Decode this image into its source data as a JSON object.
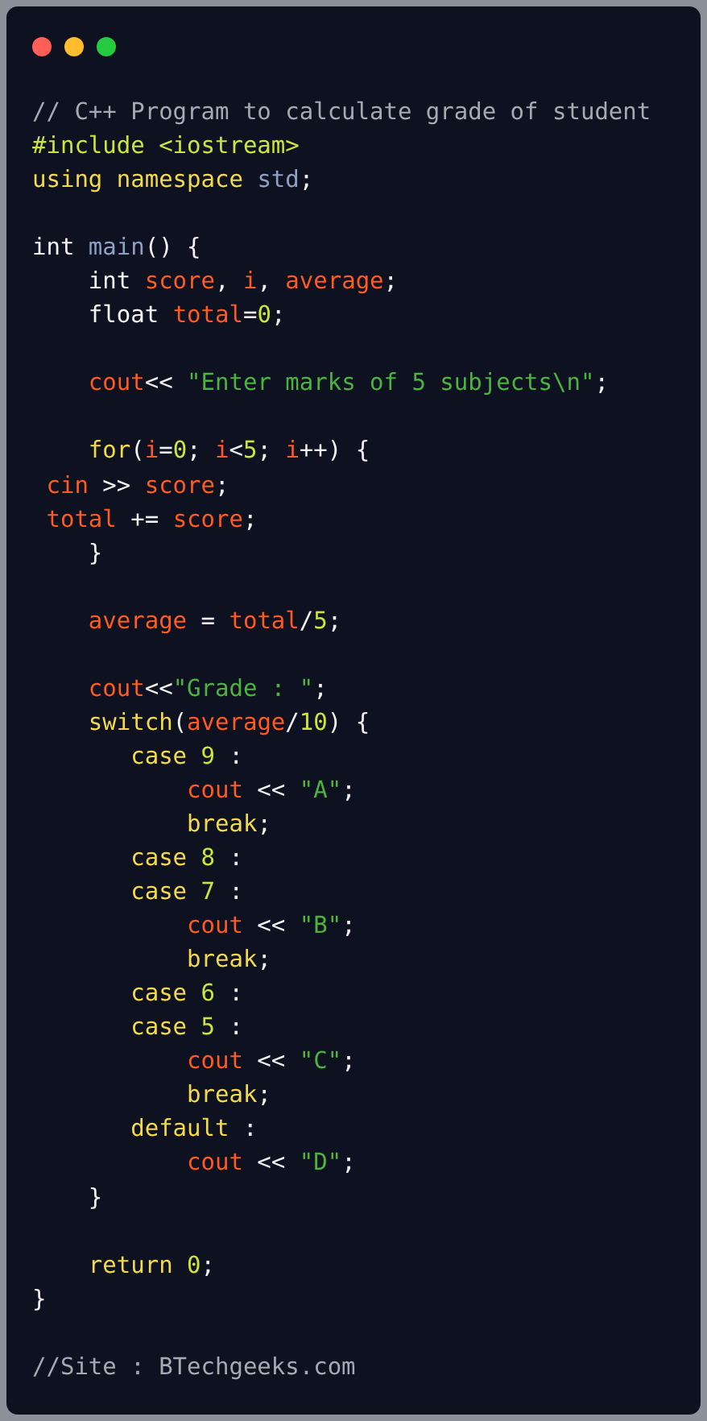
{
  "window_controls": [
    {
      "color": "#ff5f56"
    },
    {
      "color": "#ffbd2e"
    },
    {
      "color": "#27c93f"
    }
  ],
  "code_lines": [
    {
      "kind": "code",
      "tokens": [
        {
          "kind": "comment",
          "text": "// C++ Program to calculate grade of student"
        }
      ]
    },
    {
      "kind": "code",
      "tokens": [
        {
          "kind": "preproc",
          "text": "#include <iostream>"
        }
      ]
    },
    {
      "kind": "code",
      "tokens": [
        {
          "kind": "keyword",
          "text": "using namespace "
        },
        {
          "kind": "ident",
          "text": "std"
        },
        {
          "kind": "punct",
          "text": ";"
        }
      ]
    },
    {
      "kind": "blank"
    },
    {
      "kind": "code",
      "tokens": [
        {
          "kind": "type",
          "text": "int "
        },
        {
          "kind": "ident",
          "text": "main"
        },
        {
          "kind": "punct",
          "text": "() {"
        }
      ]
    },
    {
      "kind": "code",
      "tokens": [
        {
          "kind": "type",
          "text": "    int "
        },
        {
          "kind": "var",
          "text": "score"
        },
        {
          "kind": "punct",
          "text": ", "
        },
        {
          "kind": "var",
          "text": "i"
        },
        {
          "kind": "punct",
          "text": ", "
        },
        {
          "kind": "var",
          "text": "average"
        },
        {
          "kind": "punct",
          "text": ";"
        }
      ]
    },
    {
      "kind": "code",
      "tokens": [
        {
          "kind": "type",
          "text": "    float "
        },
        {
          "kind": "var",
          "text": "total"
        },
        {
          "kind": "punct",
          "text": "="
        },
        {
          "kind": "num",
          "text": "0"
        },
        {
          "kind": "punct",
          "text": ";"
        }
      ]
    },
    {
      "kind": "blank"
    },
    {
      "kind": "code",
      "tokens": [
        {
          "kind": "var",
          "text": "    cout"
        },
        {
          "kind": "punct",
          "text": "<< "
        },
        {
          "kind": "str",
          "text": "\"Enter marks of 5 subjects\\n\""
        },
        {
          "kind": "punct",
          "text": ";"
        }
      ]
    },
    {
      "kind": "blank"
    },
    {
      "kind": "code",
      "tokens": [
        {
          "kind": "keyword",
          "text": "    for"
        },
        {
          "kind": "punct",
          "text": "("
        },
        {
          "kind": "var",
          "text": "i"
        },
        {
          "kind": "punct",
          "text": "="
        },
        {
          "kind": "num",
          "text": "0"
        },
        {
          "kind": "punct",
          "text": "; "
        },
        {
          "kind": "var",
          "text": "i"
        },
        {
          "kind": "punct",
          "text": "<"
        },
        {
          "kind": "num",
          "text": "5"
        },
        {
          "kind": "punct",
          "text": "; "
        },
        {
          "kind": "var",
          "text": "i"
        },
        {
          "kind": "punct",
          "text": "++) {"
        }
      ]
    },
    {
      "kind": "code",
      "tokens": [
        {
          "kind": "var",
          "text": " cin"
        },
        {
          "kind": "punct",
          "text": " >> "
        },
        {
          "kind": "var",
          "text": "score"
        },
        {
          "kind": "punct",
          "text": ";"
        }
      ]
    },
    {
      "kind": "code",
      "tokens": [
        {
          "kind": "var",
          "text": " total"
        },
        {
          "kind": "punct",
          "text": " += "
        },
        {
          "kind": "var",
          "text": "score"
        },
        {
          "kind": "punct",
          "text": ";"
        }
      ]
    },
    {
      "kind": "code",
      "tokens": [
        {
          "kind": "punct",
          "text": "    }"
        }
      ]
    },
    {
      "kind": "blank"
    },
    {
      "kind": "code",
      "tokens": [
        {
          "kind": "var",
          "text": "    average"
        },
        {
          "kind": "punct",
          "text": " = "
        },
        {
          "kind": "var",
          "text": "total"
        },
        {
          "kind": "punct",
          "text": "/"
        },
        {
          "kind": "num",
          "text": "5"
        },
        {
          "kind": "punct",
          "text": ";"
        }
      ]
    },
    {
      "kind": "blank"
    },
    {
      "kind": "code",
      "tokens": [
        {
          "kind": "var",
          "text": "    cout"
        },
        {
          "kind": "punct",
          "text": "<<"
        },
        {
          "kind": "str",
          "text": "\"Grade : \""
        },
        {
          "kind": "punct",
          "text": ";"
        }
      ]
    },
    {
      "kind": "code",
      "tokens": [
        {
          "kind": "keyword",
          "text": "    switch"
        },
        {
          "kind": "punct",
          "text": "("
        },
        {
          "kind": "var",
          "text": "average"
        },
        {
          "kind": "punct",
          "text": "/"
        },
        {
          "kind": "num",
          "text": "10"
        },
        {
          "kind": "punct",
          "text": ") {"
        }
      ]
    },
    {
      "kind": "code",
      "tokens": [
        {
          "kind": "keyword",
          "text": "       case "
        },
        {
          "kind": "num",
          "text": "9"
        },
        {
          "kind": "punct",
          "text": " :"
        }
      ]
    },
    {
      "kind": "code",
      "tokens": [
        {
          "kind": "var",
          "text": "           cout"
        },
        {
          "kind": "punct",
          "text": " << "
        },
        {
          "kind": "str",
          "text": "\"A\""
        },
        {
          "kind": "punct",
          "text": ";"
        }
      ]
    },
    {
      "kind": "code",
      "tokens": [
        {
          "kind": "keyword",
          "text": "           break"
        },
        {
          "kind": "punct",
          "text": ";"
        }
      ]
    },
    {
      "kind": "code",
      "tokens": [
        {
          "kind": "keyword",
          "text": "       case "
        },
        {
          "kind": "num",
          "text": "8"
        },
        {
          "kind": "punct",
          "text": " :"
        }
      ]
    },
    {
      "kind": "code",
      "tokens": [
        {
          "kind": "keyword",
          "text": "       case "
        },
        {
          "kind": "num",
          "text": "7"
        },
        {
          "kind": "punct",
          "text": " :"
        }
      ]
    },
    {
      "kind": "code",
      "tokens": [
        {
          "kind": "var",
          "text": "           cout"
        },
        {
          "kind": "punct",
          "text": " << "
        },
        {
          "kind": "str",
          "text": "\"B\""
        },
        {
          "kind": "punct",
          "text": ";"
        }
      ]
    },
    {
      "kind": "code",
      "tokens": [
        {
          "kind": "keyword",
          "text": "           break"
        },
        {
          "kind": "punct",
          "text": ";"
        }
      ]
    },
    {
      "kind": "code",
      "tokens": [
        {
          "kind": "keyword",
          "text": "       case "
        },
        {
          "kind": "num",
          "text": "6"
        },
        {
          "kind": "punct",
          "text": " :"
        }
      ]
    },
    {
      "kind": "code",
      "tokens": [
        {
          "kind": "keyword",
          "text": "       case "
        },
        {
          "kind": "num",
          "text": "5"
        },
        {
          "kind": "punct",
          "text": " :"
        }
      ]
    },
    {
      "kind": "code",
      "tokens": [
        {
          "kind": "var",
          "text": "           cout"
        },
        {
          "kind": "punct",
          "text": " << "
        },
        {
          "kind": "str",
          "text": "\"C\""
        },
        {
          "kind": "punct",
          "text": ";"
        }
      ]
    },
    {
      "kind": "code",
      "tokens": [
        {
          "kind": "keyword",
          "text": "           break"
        },
        {
          "kind": "punct",
          "text": ";"
        }
      ]
    },
    {
      "kind": "code",
      "tokens": [
        {
          "kind": "keyword",
          "text": "       default"
        },
        {
          "kind": "punct",
          "text": " :"
        }
      ]
    },
    {
      "kind": "code",
      "tokens": [
        {
          "kind": "var",
          "text": "           cout"
        },
        {
          "kind": "punct",
          "text": " << "
        },
        {
          "kind": "str",
          "text": "\"D\""
        },
        {
          "kind": "punct",
          "text": ";"
        }
      ]
    },
    {
      "kind": "code",
      "tokens": [
        {
          "kind": "punct",
          "text": "    }"
        }
      ]
    },
    {
      "kind": "blank"
    },
    {
      "kind": "code",
      "tokens": [
        {
          "kind": "keyword",
          "text": "    return "
        },
        {
          "kind": "num",
          "text": "0"
        },
        {
          "kind": "punct",
          "text": ";"
        }
      ]
    },
    {
      "kind": "code",
      "tokens": [
        {
          "kind": "punct",
          "text": "}"
        }
      ]
    },
    {
      "kind": "blank"
    },
    {
      "kind": "code",
      "tokens": [
        {
          "kind": "comment",
          "text": "//Site : BTechgeeks.com"
        }
      ]
    }
  ]
}
